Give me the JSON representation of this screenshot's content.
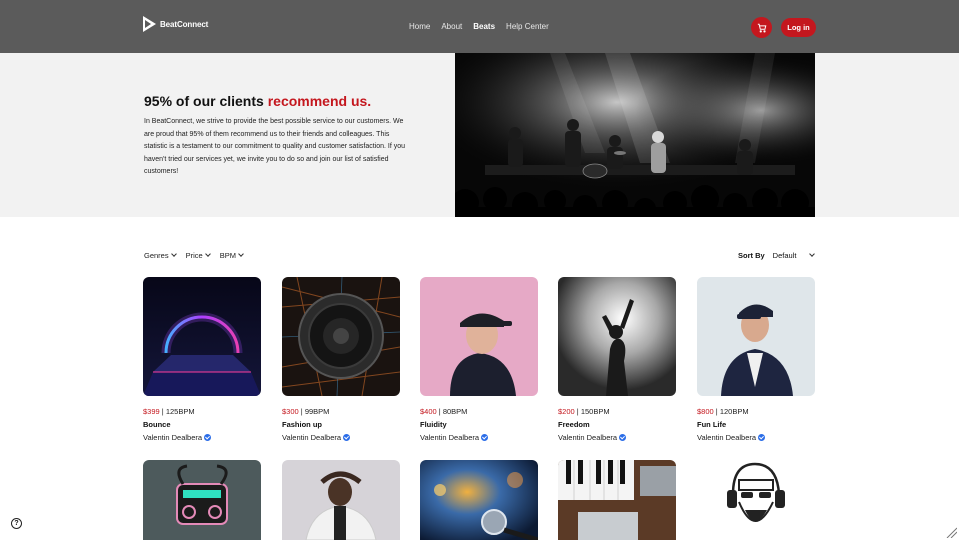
{
  "header": {
    "logo_text": "BeatConnect",
    "nav": [
      {
        "label": "Home",
        "active": false
      },
      {
        "label": "About",
        "active": false
      },
      {
        "label": "Beats",
        "active": true
      },
      {
        "label": "Help Center",
        "active": false
      }
    ],
    "login_label": "Log in"
  },
  "hero": {
    "title_prefix": "95% of our clients ",
    "title_accent": "recommend us.",
    "text": "In BeatConnect, we strive to provide the best possible service to our customers. We are proud that 95% of them recommend us to their friends and colleagues. This statistic is a testament to our commitment to quality and customer satisfaction. If you haven't tried our services yet, we invite you to do so and join our list of satisfied customers!"
  },
  "filters": {
    "items": [
      "Genres",
      "Price",
      "BPM"
    ],
    "sort_label": "Sort By",
    "sort_value": "Default"
  },
  "beats": [
    {
      "price": "$399",
      "bpm": "125BPM",
      "title": "Bounce",
      "artist": "Valentin Dealbera"
    },
    {
      "price": "$300",
      "bpm": "99BPM",
      "title": "Fashion up",
      "artist": "Valentin Dealbera"
    },
    {
      "price": "$400",
      "bpm": "80BPM",
      "title": "Fluidity",
      "artist": "Valentin Dealbera"
    },
    {
      "price": "$200",
      "bpm": "150BPM",
      "title": "Freedom",
      "artist": "Valentin Dealbera"
    },
    {
      "price": "$800",
      "bpm": "120BPM",
      "title": "Fun Life",
      "artist": "Valentin Dealbera"
    }
  ],
  "colors": {
    "accent": "#c4171e",
    "header_bg": "#5b5b5b",
    "hero_bg": "#f2f2f2",
    "verified": "#2b6de8"
  },
  "icons": {
    "cart": "cart-icon",
    "verified": "verified-badge-icon",
    "help": "help-icon"
  }
}
